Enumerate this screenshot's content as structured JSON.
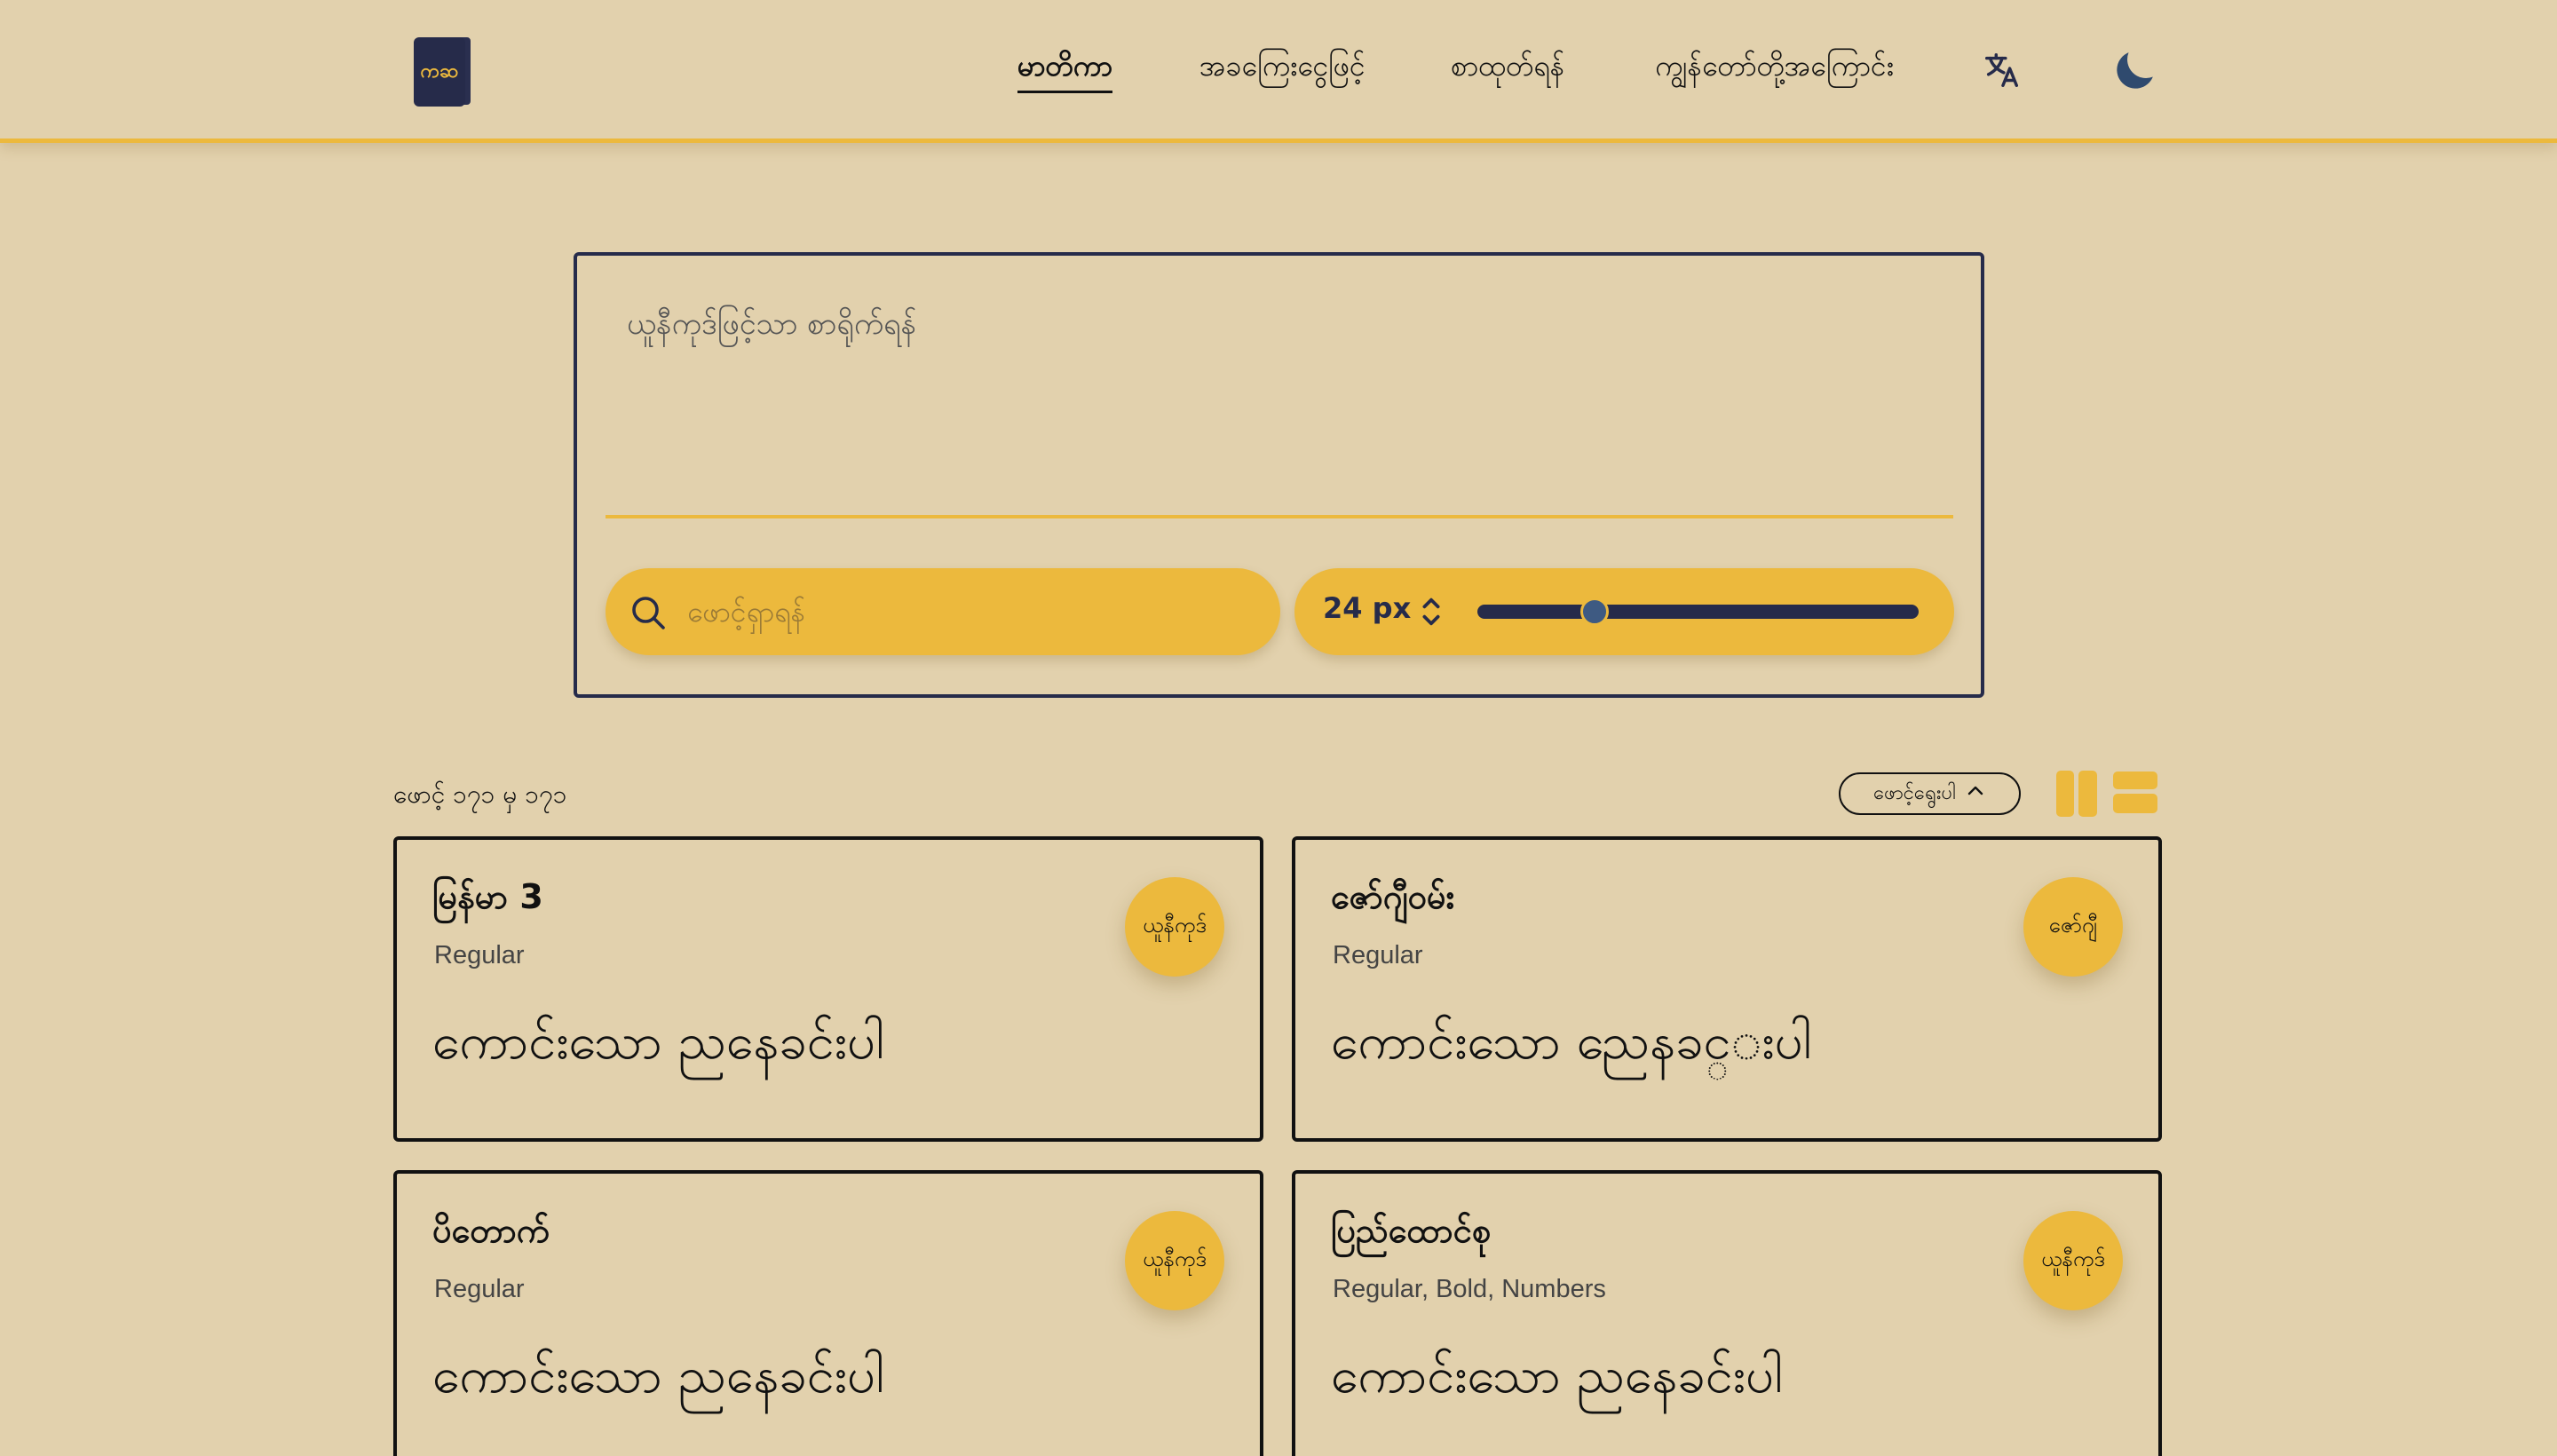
{
  "header": {
    "logo_text": "ကဆ",
    "nav": [
      {
        "label": "မာတိကာ",
        "active": true
      },
      {
        "label": "အခကြေးငွေဖြင့်",
        "active": false
      },
      {
        "label": "စာထုတ်ရန်",
        "active": false
      },
      {
        "label": "ကျွန်တော်တို့အကြောင်း",
        "active": false
      }
    ],
    "icons": [
      "translate-icon",
      "moon-icon"
    ]
  },
  "editor": {
    "placeholder": "ယူနီကုဒ်ဖြင့်သာ စာရိုက်ရန်",
    "search_placeholder": "ဖောင့်ရှာရန်",
    "font_size": "24 px",
    "slider_fraction": 0.25
  },
  "results": {
    "count_label": "ဖောင့် ၁၇၁ မှ ၁၇၁",
    "sort_label": "ဖောင့်ရွေးပါ"
  },
  "cards": [
    {
      "name": "မြန်မာ 3",
      "styles": "Regular",
      "preview": "ကောင်းသော ညနေခင်းပါ",
      "badge": "ယူနီကုဒ်"
    },
    {
      "name": "ဇော်ဂျီဝမ်း",
      "styles": "Regular",
      "preview": "ကောင်းသော ညေနခင္းပါ",
      "badge": "ဇော်ဂျီ"
    },
    {
      "name": "ပိတောက်",
      "styles": "Regular",
      "preview": "ကောင်းသော ညနေခင်းပါ",
      "badge": "ယူနီကုဒ်"
    },
    {
      "name": "ပြည်ထောင်စု",
      "styles": "Regular, Bold, Numbers",
      "preview": "ကောင်းသော ညနေခင်းပါ",
      "badge": "ယူနီကုဒ်"
    }
  ],
  "colors": {
    "background": "#e2d1ad",
    "accent": "#ecb93d",
    "navy": "#262b4a"
  }
}
